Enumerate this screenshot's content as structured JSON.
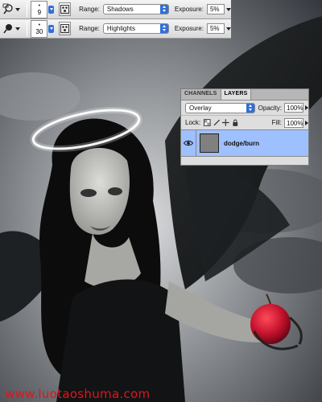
{
  "options_bar_dodge": {
    "tool_icon": "dodge-tool-icon",
    "brush_size": "9",
    "brush_panel_icon": "brush-panel-icon",
    "range_label": "Range:",
    "range_value": "Shadows",
    "exposure_label": "Exposure:",
    "exposure_value": "5%"
  },
  "options_bar_burn": {
    "tool_icon": "burn-tool-icon",
    "brush_size": "30",
    "brush_panel_icon": "brush-panel-icon",
    "range_label": "Range:",
    "range_value": "Highlights",
    "exposure_label": "Exposure:",
    "exposure_value": "5%"
  },
  "layers_panel": {
    "tabs": [
      "CHANNELS",
      "LAYERS"
    ],
    "active_tab": "LAYERS",
    "blend_mode": "Overlay",
    "opacity_label": "Opacity:",
    "opacity_value": "100%",
    "lock_label": "Lock:",
    "fill_label": "Fill:",
    "fill_value": "100%",
    "layers": [
      {
        "name": "dodge/burn",
        "visible": true,
        "selected": true
      }
    ]
  },
  "watermark": "www.luotaoshuma.com",
  "colors": {
    "selected_layer": "#9fc0ff",
    "select_arrow": "#2f6fd8",
    "watermark": "#e0141e",
    "panel_bg": "#dedede"
  }
}
